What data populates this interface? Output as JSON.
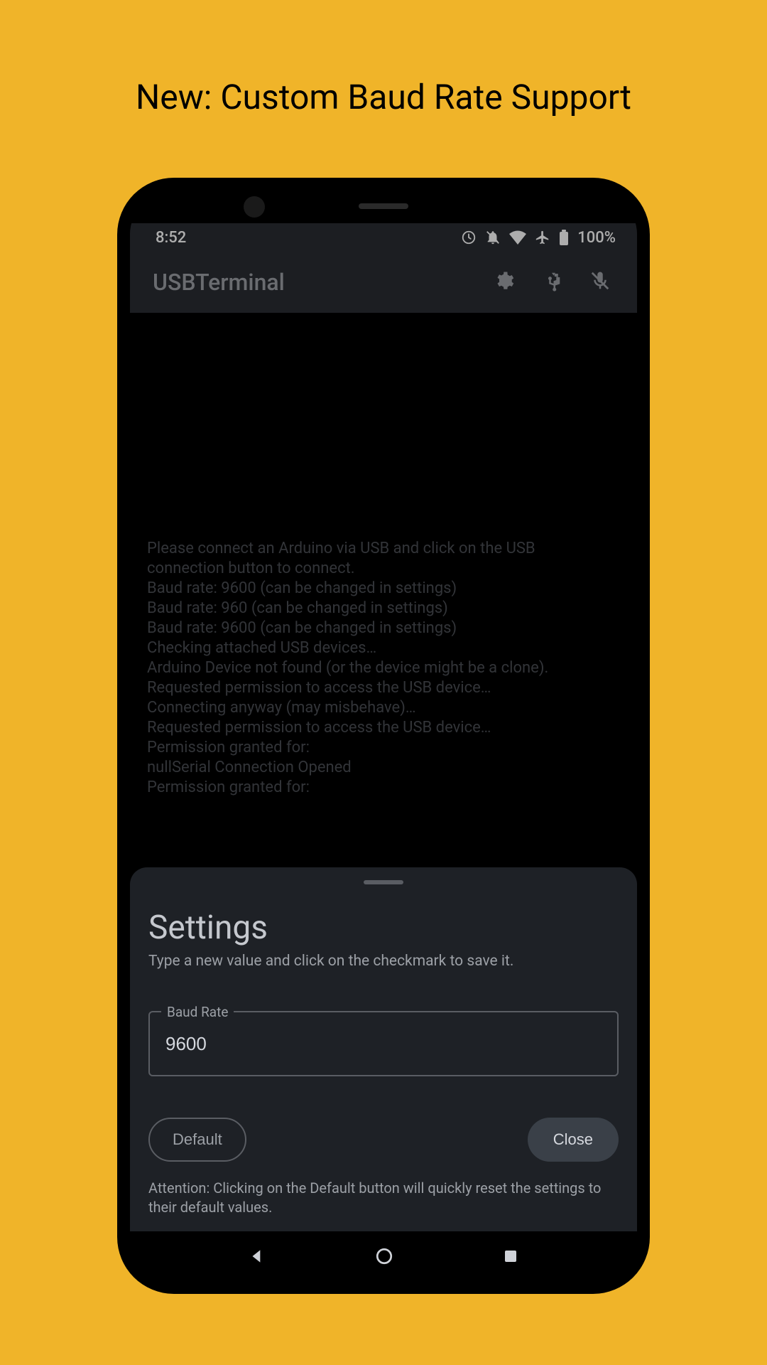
{
  "promo": {
    "title": "New: Custom Baud Rate Support"
  },
  "statusBar": {
    "time": "8:52",
    "battery": "100%"
  },
  "appBar": {
    "title": "USBTerminal"
  },
  "terminal": {
    "lines": [
      "Please connect an Arduino via USB and click on the USB",
      "connection button to connect.",
      "Baud rate: 9600 (can be changed in settings)",
      "Baud rate: 960 (can be changed in settings)",
      "Baud rate: 9600 (can be changed in settings)",
      "Checking attached USB devices…",
      "Arduino Device not found (or the device might be a clone).",
      "Requested permission to access the USB device…",
      "Connecting anyway (may misbehave)…",
      "Requested permission to access the USB device…",
      "Permission granted for:",
      " nullSerial Connection Opened",
      "Permission granted for:"
    ]
  },
  "sheet": {
    "title": "Settings",
    "subtitle": "Type a new value and click on the checkmark to save it.",
    "field": {
      "label": "Baud Rate",
      "value": "9600"
    },
    "buttons": {
      "default": "Default",
      "close": "Close"
    },
    "warning": "Attention: Clicking on the Default button will quickly reset the settings to their default values."
  }
}
